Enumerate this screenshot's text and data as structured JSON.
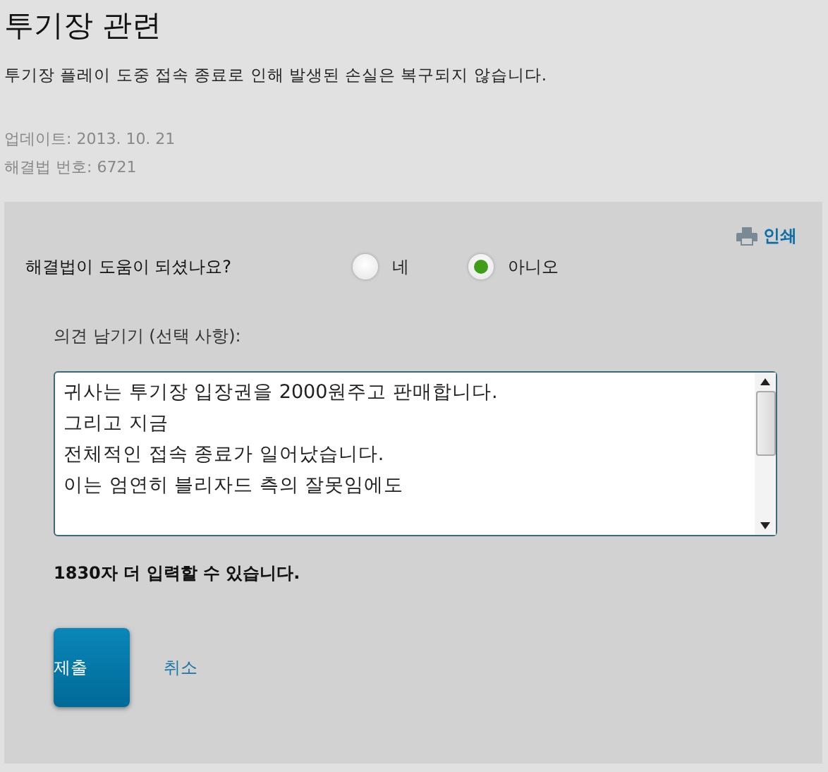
{
  "title": "투기장 관련",
  "description": "투기장 플레이 도중 접속 종료로 인해 발생된 손실은 복구되지 않습니다.",
  "meta": [
    "업데이트: 2013. 10. 21",
    "해결법 번호: 6721"
  ],
  "print_link": "인쇄",
  "question": "해결법이 도움이 되셨나요?",
  "options": [
    {
      "label": "네",
      "selected": false
    },
    {
      "label": "아니오",
      "selected": true
    }
  ],
  "comment_label": "의견 남기기 (선택 사항):",
  "comment_lines": [
    "귀사는 투기장 입장권을 2000원주고 판매합니다.",
    "그리고 지금",
    "전체적인 접속 종료가 일어났습니다.",
    "이는 엄연히 블리자드 측의 잘못임에도"
  ],
  "remaining": "1830자 더 입력할 수 있습니다.",
  "buttons": {
    "submit": "제출",
    "cancel": "취소"
  }
}
